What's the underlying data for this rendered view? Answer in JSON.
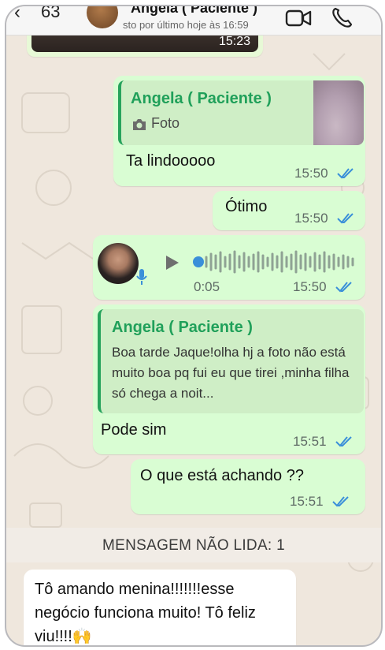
{
  "header": {
    "back_icon": "chevron-left-icon",
    "unread_count": "63",
    "contact_name": "Angela ( Paciente )",
    "status": "sto por último hoje às 16:59",
    "video_icon": "video-call-icon",
    "call_icon": "phone-call-icon"
  },
  "top_image": {
    "time": "15:23"
  },
  "messages": {
    "m1": {
      "quote_author": "Angela ( Paciente )",
      "quote_type_icon": "camera-icon",
      "quote_type": "Foto",
      "text": "Ta lindooooo",
      "time": "15:50",
      "status_icon": "double-check-read-icon"
    },
    "m2": {
      "text": "Ótimo",
      "time": "15:50"
    },
    "m3": {
      "duration": "0:05",
      "time": "15:50",
      "play_icon": "play-icon",
      "mic_icon": "microphone-icon"
    },
    "m4": {
      "quote_author": "Angela ( Paciente )",
      "quote_text": "Boa tarde Jaque!olha hj a foto não está muito boa pq fui eu que tirei ,minha filha só chega a noit...",
      "text": "Pode sim",
      "time": "15:51"
    },
    "m5": {
      "text": "O que está achando ??",
      "time": "15:51"
    }
  },
  "divider": {
    "label": "MENSAGEM NÃO LIDA: 1"
  },
  "incoming": {
    "text": "Tô amando menina!!!!!!!esse negócio funciona muito! Tô feliz viu!!!!🙌"
  },
  "colors": {
    "outgoing_bubble": "#d9fdd3",
    "incoming_bubble": "#ffffff",
    "quote_accent": "#20a05a",
    "read_tick": "#3a8fd9",
    "wallpaper": "#efe7dd"
  }
}
